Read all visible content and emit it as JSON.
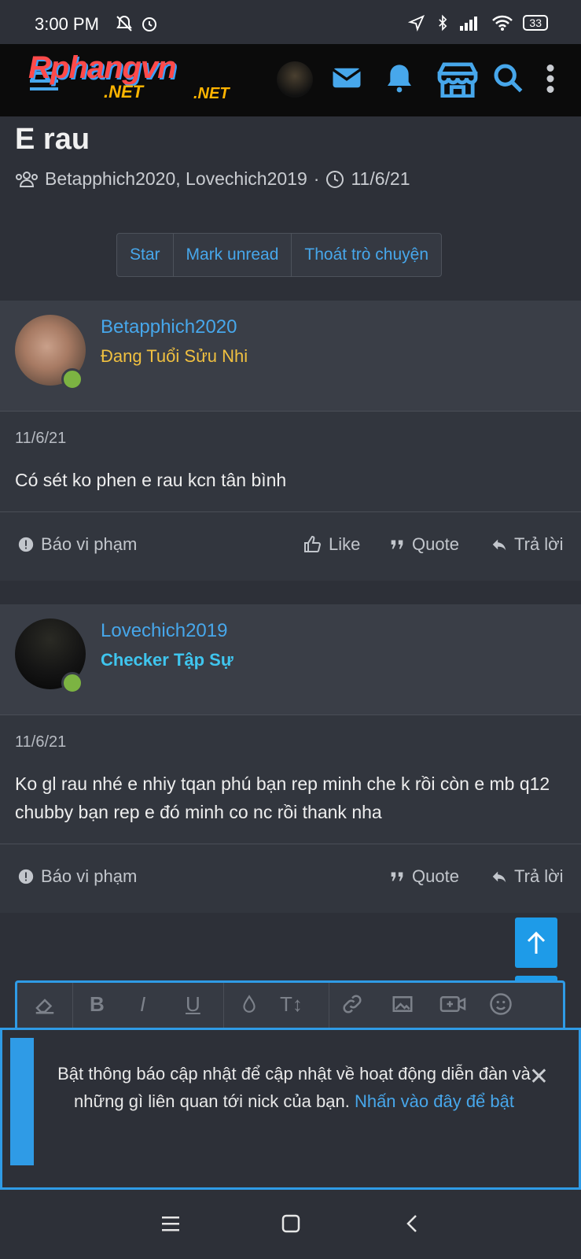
{
  "status_bar": {
    "time": "3:00 PM",
    "battery": "33"
  },
  "app_bar": {
    "logo_main": "Rphangvn",
    "logo_net1": ".NET",
    "logo_net2": ".NET",
    "icons": [
      "menu-icon",
      "avatar",
      "envelope-icon",
      "bell-icon",
      "store-icon",
      "search-icon",
      "more-vertical-icon"
    ]
  },
  "thread": {
    "title": "E rau",
    "participants": "Betapphich2020, Lovechich2019",
    "separator": "·",
    "date": "11/6/21"
  },
  "actions": {
    "star": "Star",
    "mark_unread": "Mark unread",
    "leave": "Thoát trò chuyện"
  },
  "posts": [
    {
      "username": "Betapphich2020",
      "rank": "Đang Tuổi Sửu Nhi",
      "rank_color": "#f0c040",
      "date": "11/6/21",
      "body": "Có sét ko phen e rau kcn tân bình",
      "report": "Báo vi phạm",
      "like": "Like",
      "quote": "Quote",
      "reply": "Trả lời"
    },
    {
      "username": "Lovechich2019",
      "rank": "Checker Tập Sự",
      "rank_color": "#3fc5ee",
      "date": "11/6/21",
      "body": "Ko gl rau nhé e nhiy tqan phú bạn rep minh che k rồi còn e mb q12 chubby bạn rep e đó minh co nc rồi thank nha",
      "report": "Báo vi phạm",
      "quote": "Quote",
      "reply": "Trả lời"
    }
  ],
  "notice": {
    "text": "Bật thông báo cập nhật để cập nhật về hoạt động diễn đàn và những gì liên quan tới nick của bạn.",
    "link": "Nhấn vào đây để bật",
    "close": "✕"
  },
  "colors": {
    "accent": "#47a7eb",
    "button_blue": "#1e9be8",
    "online": "#7cb342"
  }
}
